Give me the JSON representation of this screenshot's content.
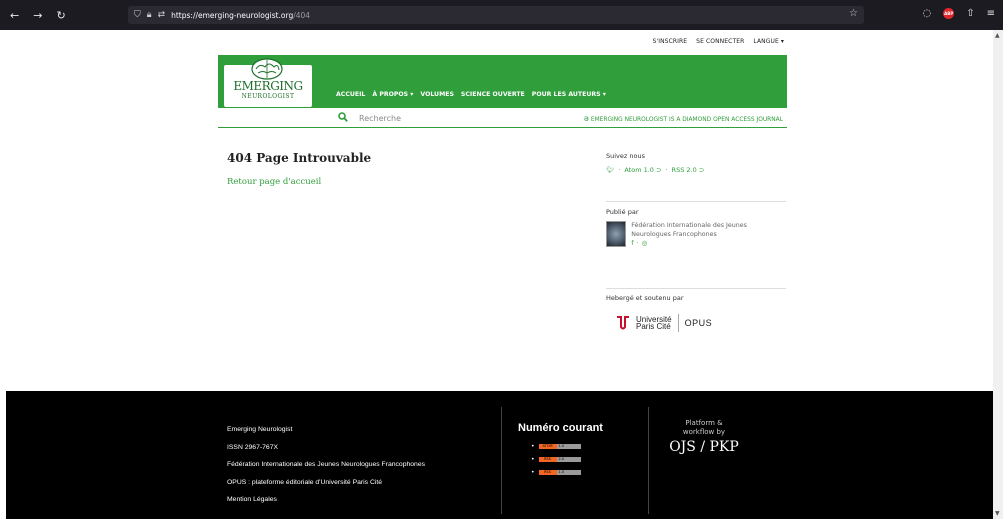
{
  "browser": {
    "url_host": "https://emerging-neurologist.org",
    "url_path": "/404"
  },
  "topnav": {
    "register": "S'INSCRIRE",
    "login": "SE CONNECTER",
    "language": "LANGUE ▾"
  },
  "logo": {
    "line1": "EMERGING",
    "line2": "NEUROLOGIST"
  },
  "mainnav": {
    "items": [
      "ACCUEIL",
      "À PROPOS ▾",
      "VOLUMES",
      "SCIENCE OUVERTE",
      "POUR LES AUTEURS ▾"
    ]
  },
  "search": {
    "placeholder": "Recherche"
  },
  "banner": {
    "text": "EMERGING NEUROLOGIST IS A DIAMOND OPEN ACCESS JOURNAL"
  },
  "main": {
    "title": "404 Page Introuvable",
    "back_link": "Retour page d'accueil"
  },
  "sidebar": {
    "follow_title": "Suivez nous",
    "atom": "Atom 1.0",
    "rss": "RSS 2.0",
    "published_title": "Publié par",
    "publisher": "Fédération Internationale des Jeunes Neurologues Francophones",
    "hosted_title": "Hebergé et soutenu par",
    "univ_line1": "Université",
    "univ_line2": "Paris Cité",
    "opus": "OPUS"
  },
  "footer": {
    "links": [
      "Emerging Neurologist",
      "ISSN 2967-767X",
      "Fédération Internationale des Jeunes Neurologues Francophones",
      "OPUS : plateforme éditoriale d'Université Paris Cité",
      "Mention Légales"
    ],
    "current_issue": "Numéro courant",
    "badges": [
      {
        "left": "ATOM",
        "right": "1.0"
      },
      {
        "left": "RSS",
        "right": "2.0"
      },
      {
        "left": "RSS",
        "right": "1.0"
      }
    ],
    "pkp_line1": "Platform &",
    "pkp_line2": "workflow by",
    "pkp_logo": "OJS / PKP"
  },
  "colors": {
    "brand_green": "#2f9e3b",
    "footer_bg": "#000000"
  }
}
